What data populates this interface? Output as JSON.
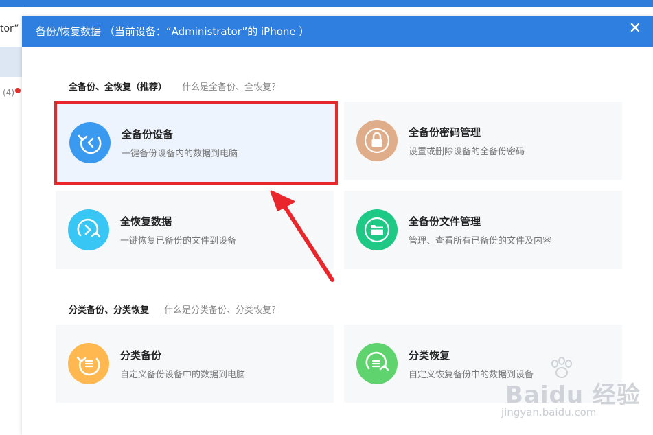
{
  "background_app": {
    "left_text_fragment": "tor”",
    "badge_count": "(4)"
  },
  "dialog": {
    "title": "备份/恢复数据  （当前设备：“Administrator”的 iPhone ）",
    "close_glyph": "✕"
  },
  "sections": [
    {
      "title": "全备份、全恢复（推荐）",
      "help_link": "什么是全备份、全恢复？",
      "cards": [
        {
          "title": "全备份设备",
          "desc": "一键备份设备内的数据到电脑",
          "icon": "backup-arrow-icon",
          "color": "#3a9af0",
          "selected": true
        },
        {
          "title": "全备份密码管理",
          "desc": "设置或删除设备的全备份密码",
          "icon": "lock-icon",
          "color": "#e0ad8a",
          "selected": false
        },
        {
          "title": "全恢复数据",
          "desc": "一键恢复已备份的文件到设备",
          "icon": "restore-arrow-icon",
          "color": "#38c6f4",
          "selected": false
        },
        {
          "title": "全备份文件管理",
          "desc": "管理、查看所有已备份的文件及内容",
          "icon": "folder-icon",
          "color": "#1ec985",
          "selected": false
        }
      ]
    },
    {
      "title": "分类备份、分类恢复",
      "help_link": "什么是分类备份、分类恢复？",
      "cards": [
        {
          "title": "分类备份",
          "desc": "自定义备份设备中的数据到电脑",
          "icon": "category-backup-icon",
          "color": "#ffb84f",
          "selected": false
        },
        {
          "title": "分类恢复",
          "desc": "自定义恢复备份中的数据到设备",
          "icon": "category-restore-icon",
          "color": "#5fd36e",
          "selected": false
        }
      ]
    }
  ],
  "annotation": {
    "highlight_color": "#e8262b"
  },
  "watermark": {
    "brand": "Baidu 经验",
    "url": "jingyan.baidu.com"
  }
}
